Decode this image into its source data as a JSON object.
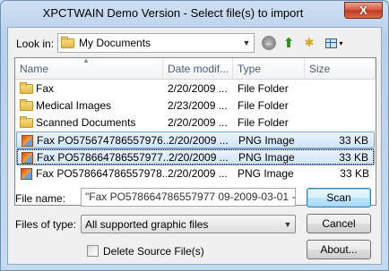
{
  "window": {
    "title": "XPCTWAIN Demo Version - Select file(s) to import",
    "close_glyph": "X"
  },
  "lookin": {
    "label": "Look in:",
    "value": "My Documents"
  },
  "toolbar": {
    "back_glyph": "←",
    "up_glyph": "⬆",
    "newfolder_glyph": "✱",
    "views_arrow": "▾"
  },
  "columns": {
    "name": "Name",
    "date": "Date modif...",
    "type": "Type",
    "size": "Size"
  },
  "files": [
    {
      "name": "Fax",
      "date": "2/20/2009 ...",
      "type": "File Folder",
      "size": "",
      "icon": "folder-icon"
    },
    {
      "name": "Medical Images",
      "date": "2/23/2009 ...",
      "type": "File Folder",
      "size": "",
      "icon": "folder-icon"
    },
    {
      "name": "Scanned Documents",
      "date": "2/20/2009 ...",
      "type": "File Folder",
      "size": "",
      "icon": "folder-icon"
    },
    {
      "name": "Fax PO575674786557976...",
      "date": "2/20/2009 ...",
      "type": "PNG Image",
      "size": "33 KB",
      "icon": "png-image-icon",
      "selected": true
    },
    {
      "name": "Fax PO578664786557977...",
      "date": "2/20/2009 ...",
      "type": "PNG Image",
      "size": "33 KB",
      "icon": "png-image-icon",
      "selected": true,
      "focused": true
    },
    {
      "name": "Fax PO578664786557978...",
      "date": "2/20/2009 ...",
      "type": "PNG Image",
      "size": "33 KB",
      "icon": "png-image-icon"
    }
  ],
  "filename": {
    "label": "File name:",
    "value": "\"Fax PO578664786557977 09-2009-03-01 - Cop"
  },
  "filetype": {
    "label": "Files of type:",
    "value": "All supported graphic files"
  },
  "delete_source": {
    "label": "Delete Source File(s)",
    "checked": false
  },
  "buttons": {
    "scan": "Scan",
    "cancel": "Cancel",
    "about": "About..."
  },
  "colors": {
    "selection": "#cfe4fb",
    "titlebar": "#bfd6ee",
    "close": "#c23a20"
  }
}
